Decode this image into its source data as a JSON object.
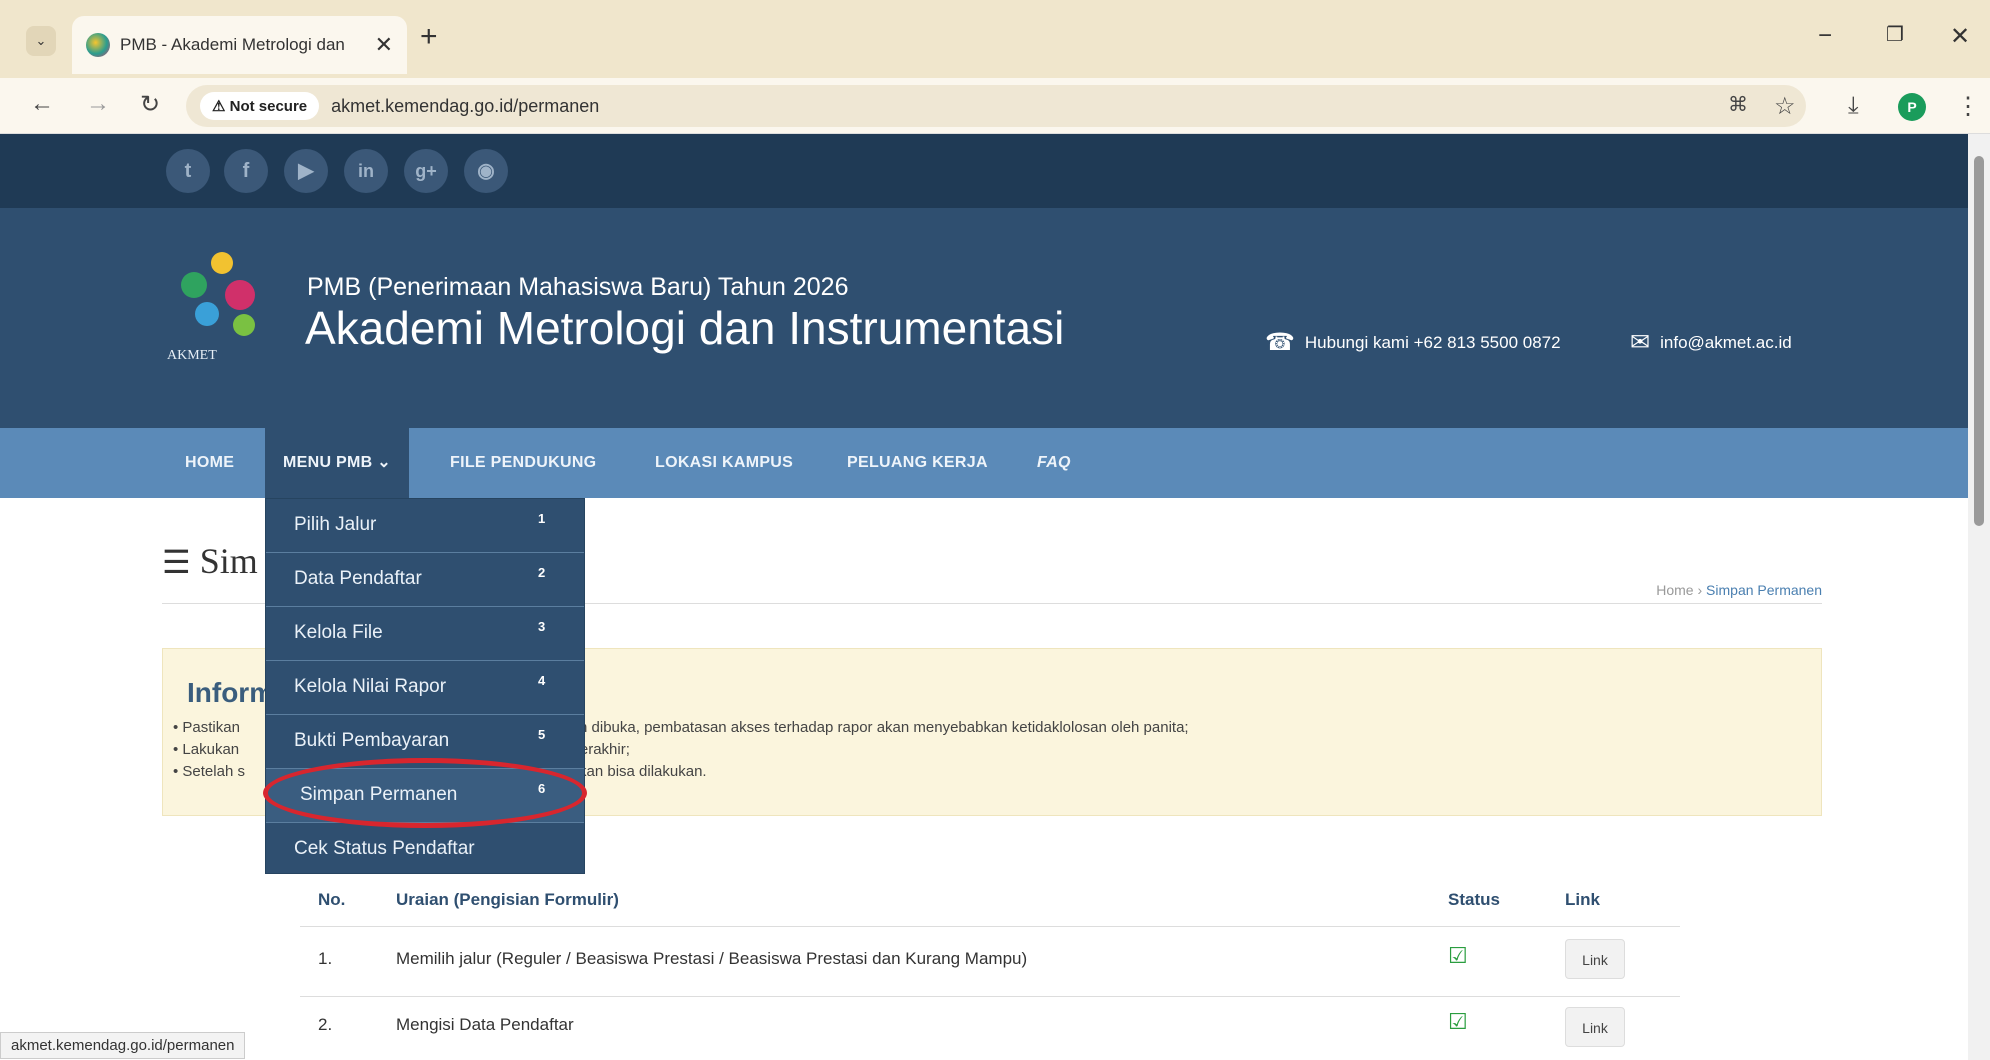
{
  "browser": {
    "tab_title": "PMB - Akademi Metrologi dan",
    "tab_close": "✕",
    "new_tab": "+",
    "security_label": "Not secure",
    "url": "akmet.kemendag.go.id/permanen",
    "profile_initial": "P",
    "window_controls": {
      "minimize": "−",
      "restore": "❐",
      "close": "✕"
    },
    "status_url": "akmet.kemendag.go.id/permanen"
  },
  "social_icons": [
    "twitter-icon",
    "facebook-icon",
    "youtube-icon",
    "linkedin-icon",
    "google-plus-icon",
    "rss-icon"
  ],
  "header": {
    "logo_text": "AKMET",
    "subtitle": "PMB (Penerimaan Mahasiswa Baru) Tahun 2026",
    "title": "Akademi Metrologi dan Instrumentasi",
    "phone": "Hubungi kami +62 813 5500 0872",
    "email": "info@akmet.ac.id"
  },
  "nav": {
    "home": "HOME",
    "menu_pmb": "MENU PMB ⌄",
    "file_pendukung": "FILE PENDUKUNG",
    "lokasi_kampus": "LOKASI KAMPUS",
    "peluang_kerja": "PELUANG KERJA",
    "faq": "FAQ"
  },
  "dropdown": [
    {
      "label": "Pilih Jalur",
      "num": "1"
    },
    {
      "label": "Data Pendaftar",
      "num": "2"
    },
    {
      "label": "Kelola File",
      "num": "3"
    },
    {
      "label": "Kelola Nilai Rapor",
      "num": "4"
    },
    {
      "label": "Bukti Pembayaran",
      "num": "5"
    },
    {
      "label": "Simpan Permanen",
      "num": "6"
    },
    {
      "label": "Cek Status Pendaftar",
      "num": ""
    }
  ],
  "page": {
    "title": "Sim",
    "breadcrumb_home": "Home",
    "breadcrumb_sep": "›",
    "breadcrumb_current": "Simpan Permanen"
  },
  "info": {
    "title": "Inform",
    "lines": [
      {
        "start": "• Pastikan",
        "end": "elah dibuka, pembatasan akses terhadap rapor akan menyebabkan ketidaklolosan oleh panita;"
      },
      {
        "start": "• Lakukan",
        "end": "u berakhir;"
      },
      {
        "start": "• Setelah s",
        "end": "k akan bisa dilakukan."
      }
    ]
  },
  "table": {
    "headers": {
      "no": "No.",
      "uraian": "Uraian (Pengisian Formulir)",
      "status": "Status",
      "link": "Link"
    },
    "rows": [
      {
        "no": "1.",
        "uraian": "Memilih jalur (Reguler / Beasiswa Prestasi / Beasiswa Prestasi dan Kurang Mampu)",
        "status": "☑",
        "link": "Link"
      },
      {
        "no": "2.",
        "uraian": "Mengisi Data Pendaftar",
        "status": "☑",
        "link": "Link"
      }
    ]
  },
  "colors": {
    "topbar": "#1f3a55",
    "header": "#2f4f70",
    "nav": "#5b8ab8",
    "highlight": "#d8262e",
    "check": "#2a9d3f"
  }
}
